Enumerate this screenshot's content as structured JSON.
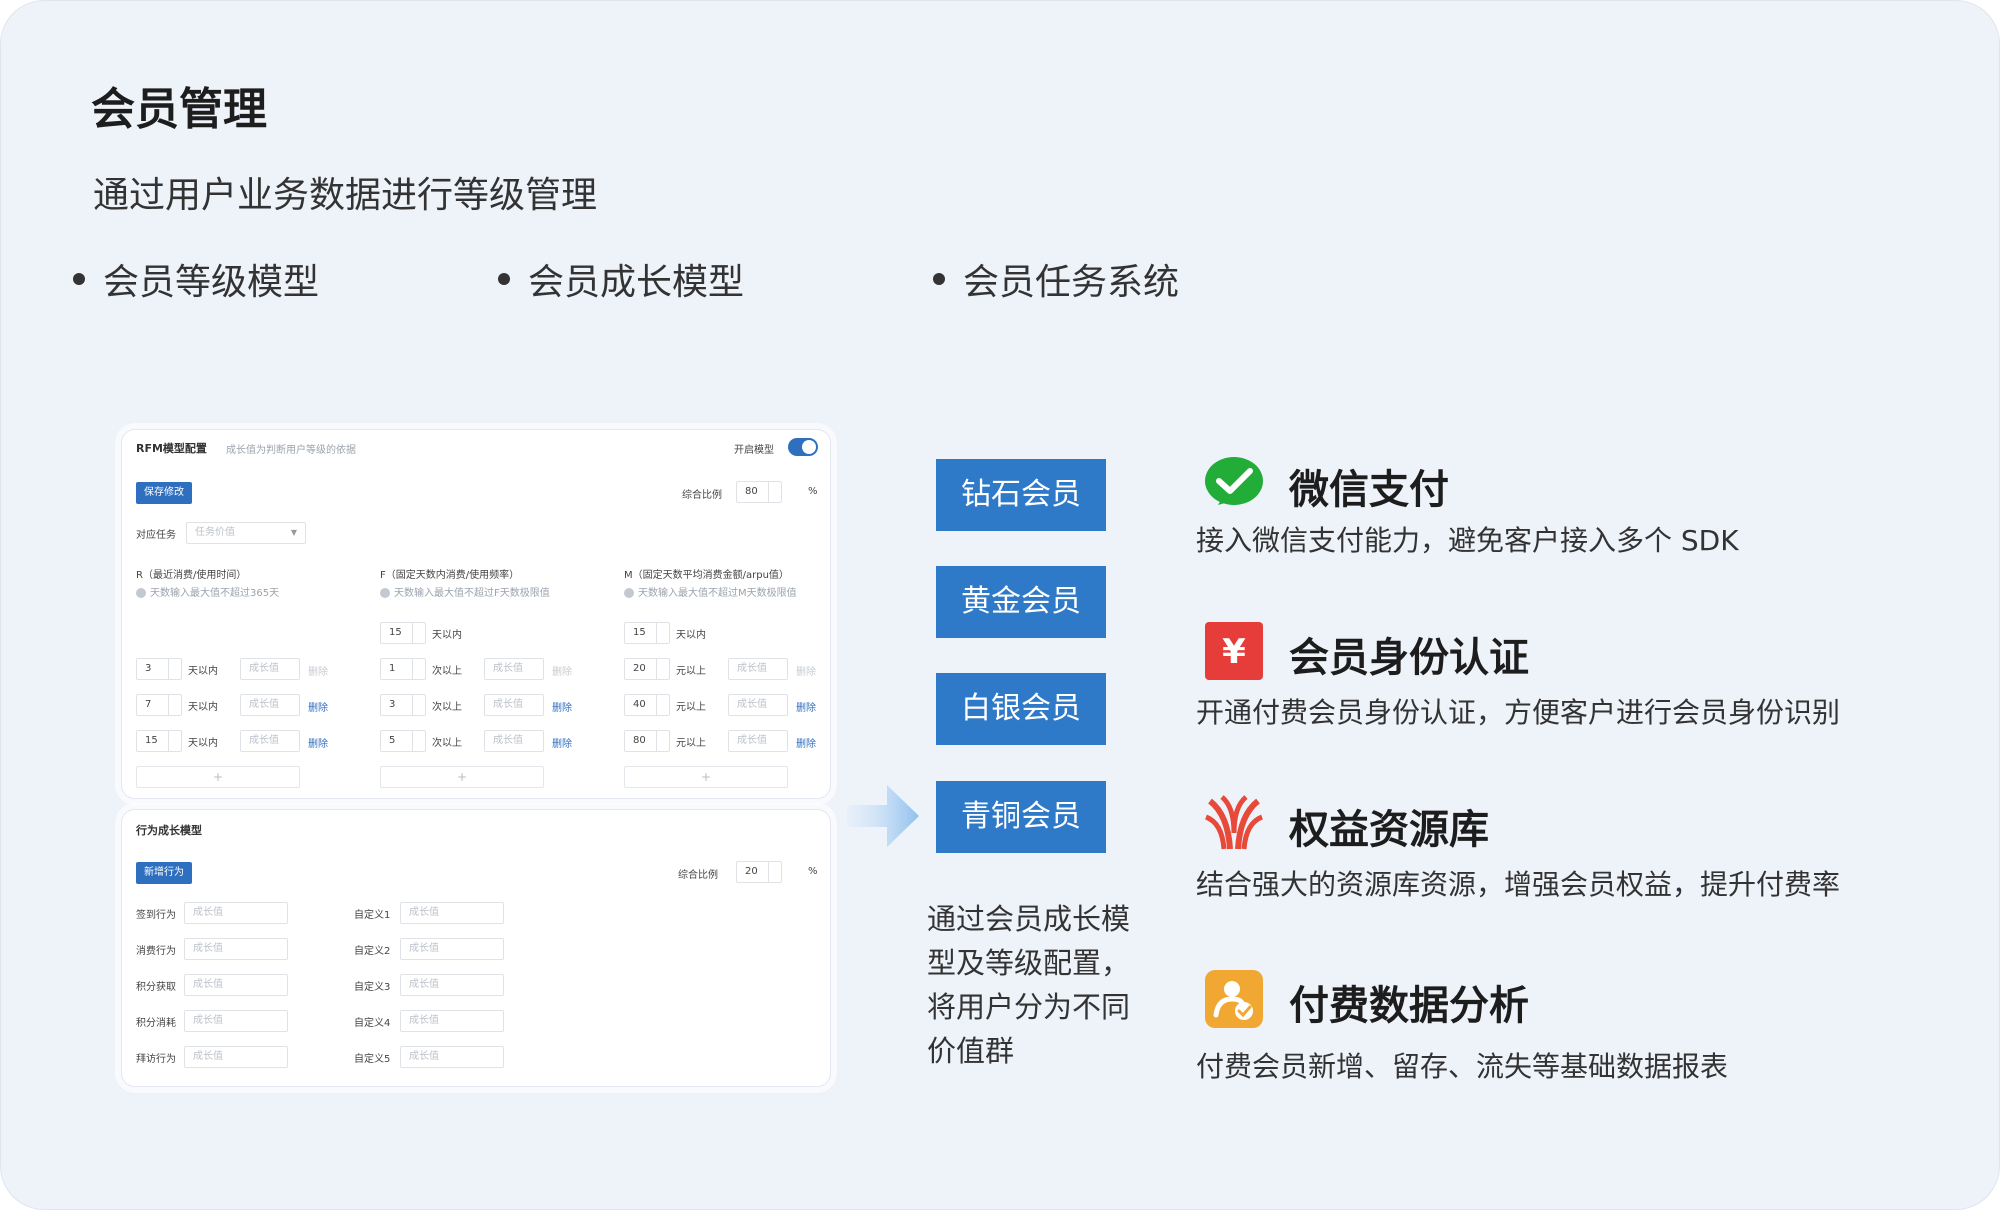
{
  "header": {
    "title": "会员管理",
    "subtitle": "通过用户业务数据进行等级管理"
  },
  "bullets": [
    "会员等级模型",
    "会员成长模型",
    "会员任务系统"
  ],
  "rfm_panel": {
    "title": "RFM模型配置",
    "hint": "成长值为判断用户等级的依据",
    "toggle_label": "开启模型",
    "save_button": "保存修改",
    "ratio_label": "综合比例",
    "ratio_value": "80",
    "percent": "%",
    "task_label": "对应任务",
    "task_placeholder": "任务价值",
    "columns": [
      {
        "title": "R（最近消费/使用时间）",
        "note": "天数输入最大值不超过365天",
        "rows": [
          {
            "num": "3",
            "unit": "天以内",
            "placeholder": "成长值",
            "del": "删除"
          },
          {
            "num": "7",
            "unit": "天以内",
            "placeholder": "成长值",
            "del": "删除"
          },
          {
            "num": "15",
            "unit": "天以内",
            "placeholder": "成长值",
            "del": "删除"
          }
        ]
      },
      {
        "title": "F（固定天数内消费/使用频率）",
        "note": "天数输入最大值不超过F天数极限值",
        "top": {
          "num": "15",
          "unit": "天以内"
        },
        "rows": [
          {
            "num": "1",
            "unit": "次以上",
            "placeholder": "成长值",
            "del": "删除"
          },
          {
            "num": "3",
            "unit": "次以上",
            "placeholder": "成长值",
            "del": "删除"
          },
          {
            "num": "5",
            "unit": "次以上",
            "placeholder": "成长值",
            "del": "删除"
          }
        ]
      },
      {
        "title": "M（固定天数平均消费金额/arpu值）",
        "note": "天数输入最大值不超过M天数极限值",
        "top": {
          "num": "15",
          "unit": "天以内"
        },
        "rows": [
          {
            "num": "20",
            "unit": "元以上",
            "placeholder": "成长值",
            "del": "删除"
          },
          {
            "num": "40",
            "unit": "元以上",
            "placeholder": "成长值",
            "del": "删除"
          },
          {
            "num": "80",
            "unit": "元以上",
            "placeholder": "成长值",
            "del": "删除"
          }
        ]
      }
    ],
    "add_symbol": "+"
  },
  "behavior_panel": {
    "title": "行为成长模型",
    "add_button": "新增行为",
    "ratio_label": "综合比例",
    "ratio_value": "20",
    "percent": "%",
    "left_rows": [
      "签到行为",
      "消费行为",
      "积分获取",
      "积分消耗",
      "拜访行为"
    ],
    "right_rows": [
      "自定义1",
      "自定义2",
      "自定义3",
      "自定义4",
      "自定义5"
    ],
    "placeholder": "成长值"
  },
  "tiers": [
    "钻石会员",
    "黄金会员",
    "白银会员",
    "青铜会员"
  ],
  "tier_description": "通过会员成长模型及等级配置，将用户分为不同价值群",
  "features": [
    {
      "icon": "wechat-pay-icon",
      "title": "微信支付",
      "desc": "接入微信支付能力，避免客户接入多个 SDK"
    },
    {
      "icon": "yen-icon",
      "title": "会员身份认证",
      "desc": "开通付费会员身份认证，方便客户进行会员身份识别"
    },
    {
      "icon": "resource-library-icon",
      "title": "权益资源库",
      "desc": "结合强大的资源库资源，增强会员权益，提升付费率"
    },
    {
      "icon": "user-verified-icon",
      "title": "付费数据分析",
      "desc": "付费会员新增、留存、流失等基础数据报表"
    }
  ],
  "colors": {
    "background": "#eef3fa",
    "tier_blue": "#2f7ac8",
    "wechat_green": "#22ac38",
    "auth_red": "#e63c3a",
    "resource_red": "#e84a3a",
    "analysis_orange": "#f0a833"
  }
}
